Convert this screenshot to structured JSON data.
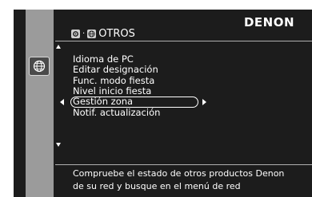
{
  "brand": "DENON",
  "header": {
    "title": "OTROS",
    "icon": "gear-icon",
    "sub_icon": "globe-icon"
  },
  "sidebar": {
    "icon": "globe-icon"
  },
  "menu": {
    "items": [
      {
        "label": "Idioma de PC"
      },
      {
        "label": "Editar designación"
      },
      {
        "label": "Func. modo fiesta"
      },
      {
        "label": "Nivel inicio fiesta"
      },
      {
        "label": "Gestión zona",
        "selected": true
      },
      {
        "label": "Notif. actualización"
      }
    ]
  },
  "description": {
    "line1": "Compruebe el estado de otros productos Denon",
    "line2": "de su red y busque en el menú de red"
  }
}
